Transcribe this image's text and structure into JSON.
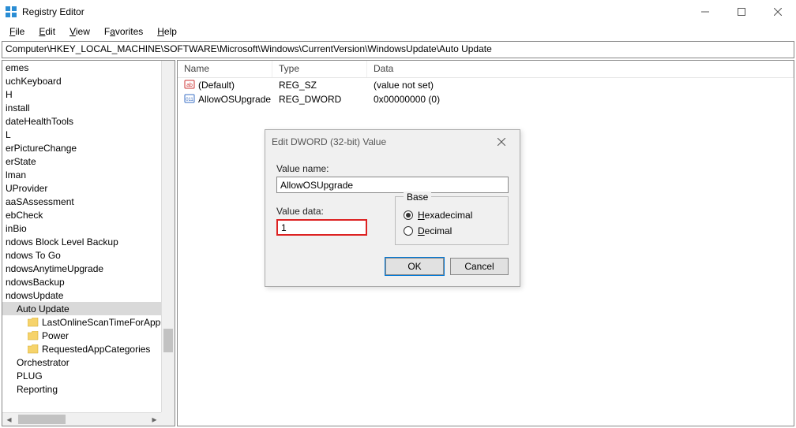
{
  "titlebar": {
    "title": "Registry Editor"
  },
  "menu": {
    "file": "File",
    "edit": "Edit",
    "view": "View",
    "favorites": "Favorites",
    "help": "Help"
  },
  "address": "Computer\\HKEY_LOCAL_MACHINE\\SOFTWARE\\Microsoft\\Windows\\CurrentVersion\\WindowsUpdate\\Auto Update",
  "tree": {
    "items": [
      {
        "label": "emes",
        "indent": 0
      },
      {
        "label": "uchKeyboard",
        "indent": 0
      },
      {
        "label": "H",
        "indent": 0
      },
      {
        "label": "install",
        "indent": 0
      },
      {
        "label": "dateHealthTools",
        "indent": 0
      },
      {
        "label": "L",
        "indent": 0
      },
      {
        "label": "erPictureChange",
        "indent": 0
      },
      {
        "label": "erState",
        "indent": 0
      },
      {
        "label": "lman",
        "indent": 0
      },
      {
        "label": "UProvider",
        "indent": 0
      },
      {
        "label": "aaSAssessment",
        "indent": 0
      },
      {
        "label": "ebCheck",
        "indent": 0
      },
      {
        "label": "inBio",
        "indent": 0
      },
      {
        "label": "ndows Block Level Backup",
        "indent": 0
      },
      {
        "label": "ndows To Go",
        "indent": 0
      },
      {
        "label": "ndowsAnytimeUpgrade",
        "indent": 0
      },
      {
        "label": "ndowsBackup",
        "indent": 0
      },
      {
        "label": "ndowsUpdate",
        "indent": 0
      },
      {
        "label": "Auto Update",
        "indent": 1,
        "selected": true
      },
      {
        "label": "LastOnlineScanTimeForAppCateg",
        "indent": 2,
        "folder": true
      },
      {
        "label": "Power",
        "indent": 2,
        "folder": true
      },
      {
        "label": "RequestedAppCategories",
        "indent": 2,
        "folder": true
      },
      {
        "label": "Orchestrator",
        "indent": 1
      },
      {
        "label": "PLUG",
        "indent": 1
      },
      {
        "label": "Reporting",
        "indent": 1
      }
    ]
  },
  "list": {
    "headers": {
      "name": "Name",
      "type": "Type",
      "data": "Data"
    },
    "rows": [
      {
        "icon": "sz",
        "name": "(Default)",
        "type": "REG_SZ",
        "data": "(value not set)"
      },
      {
        "icon": "dw",
        "name": "AllowOSUpgrade",
        "type": "REG_DWORD",
        "data": "0x00000000 (0)"
      }
    ]
  },
  "dialog": {
    "title": "Edit DWORD (32-bit) Value",
    "value_name_label": "Value name:",
    "value_name": "AllowOSUpgrade",
    "value_data_label": "Value data:",
    "value_data": "1",
    "base_label": "Base",
    "hex_label": "Hexadecimal",
    "dec_label": "Decimal",
    "ok": "OK",
    "cancel": "Cancel"
  }
}
